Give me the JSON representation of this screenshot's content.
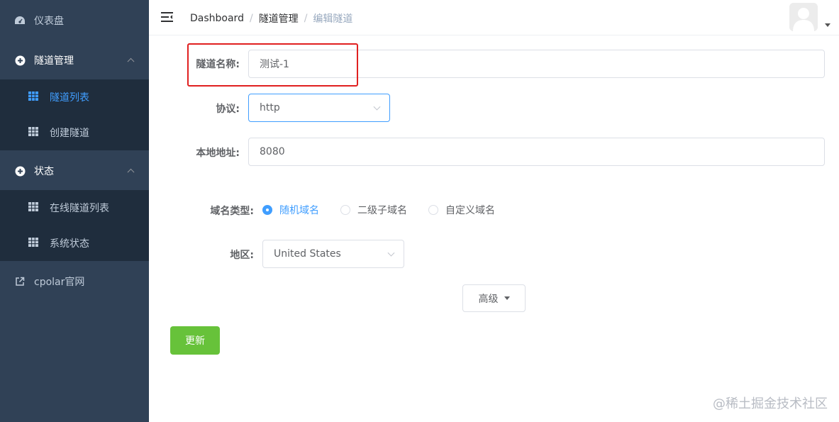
{
  "sidebar": {
    "dashboard": "仪表盘",
    "tunnel_mgmt": "隧道管理",
    "tunnel_list": "隧道列表",
    "create_tunnel": "创建隧道",
    "status": "状态",
    "online_tunnels": "在线隧道列表",
    "system_status": "系统状态",
    "cpolar_site": "cpolar官网"
  },
  "breadcrumb": {
    "home": "Dashboard",
    "sep1": "/",
    "section": "隧道管理",
    "sep2": "/",
    "current": "编辑隧道"
  },
  "form": {
    "name_label": "隧道名称:",
    "name_value": "测试-1",
    "protocol_label": "协议:",
    "protocol_value": "http",
    "local_label": "本地地址:",
    "local_value": "8080",
    "domain_type_label": "域名类型:",
    "domain_options": [
      "随机域名",
      "二级子域名",
      "自定义域名"
    ],
    "domain_selected": "随机域名",
    "region_label": "地区:",
    "region_value": "United States",
    "advanced_button": "高级",
    "update_button": "更新"
  },
  "watermark": "@稀土掘金技术社区",
  "colors": {
    "sidebar_bg": "#304156",
    "submenu_bg": "#1f2d3d",
    "accent": "#409eff",
    "success": "#67c23a",
    "highlight": "#e02020"
  }
}
